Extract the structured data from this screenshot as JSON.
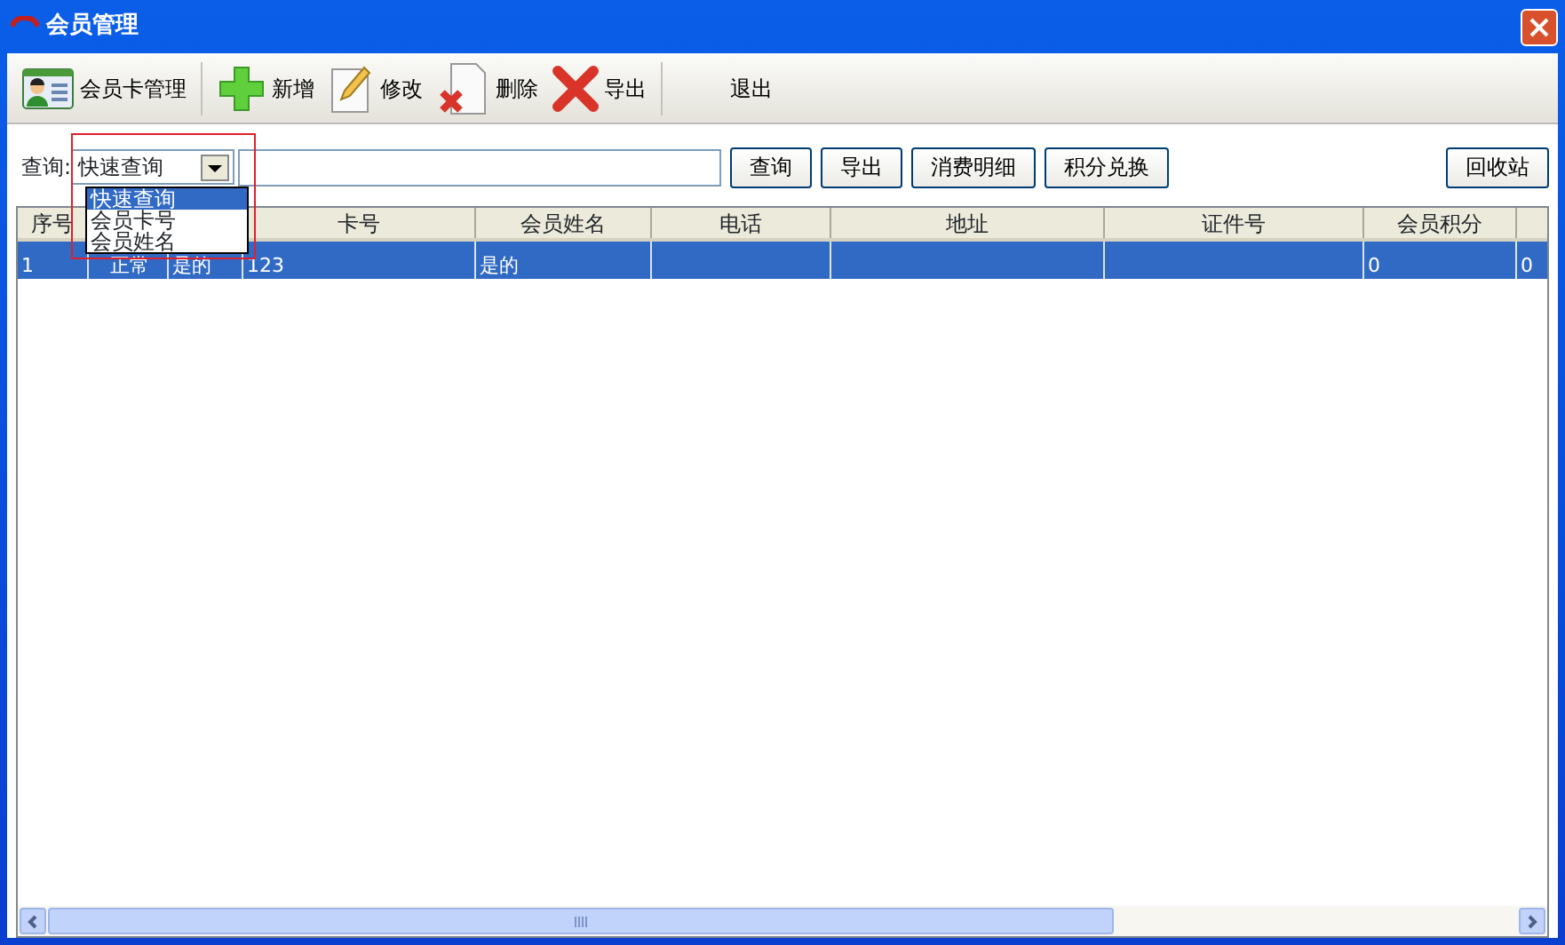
{
  "window": {
    "title": "会员管理"
  },
  "toolbar": [
    {
      "kind": "card",
      "label": "会员卡管理"
    },
    {
      "kind": "separator"
    },
    {
      "kind": "plus",
      "label": "新增"
    },
    {
      "kind": "pencil",
      "label": "修改"
    },
    {
      "kind": "delete",
      "label": "删除"
    },
    {
      "kind": "cross",
      "label": "导出"
    },
    {
      "kind": "separator"
    },
    {
      "kind": "text",
      "label": "退出"
    }
  ],
  "search": {
    "label": "查询:",
    "combo_value": "快速查询",
    "options": [
      {
        "label": "快速查询",
        "selected": true
      },
      {
        "label": "会员卡号",
        "selected": false
      },
      {
        "label": "会员姓名",
        "selected": false
      }
    ]
  },
  "buttons": [
    "查询",
    "导出",
    "消费明细",
    "积分兑换"
  ],
  "recycle_button": "回收站",
  "table": {
    "columns": [
      {
        "label": "序号"
      },
      {},
      {},
      {
        "label": "卡号"
      },
      {
        "label": "会员姓名"
      },
      {
        "label": "电话"
      },
      {
        "label": "地址"
      },
      {
        "label": "证件号"
      },
      {
        "label": "会员积分"
      },
      {}
    ],
    "rows": [
      {
        "selected": true,
        "cells": [
          "1",
          "正常",
          "是的",
          "123",
          "是的",
          null,
          null,
          null,
          "0",
          "0"
        ]
      }
    ]
  }
}
